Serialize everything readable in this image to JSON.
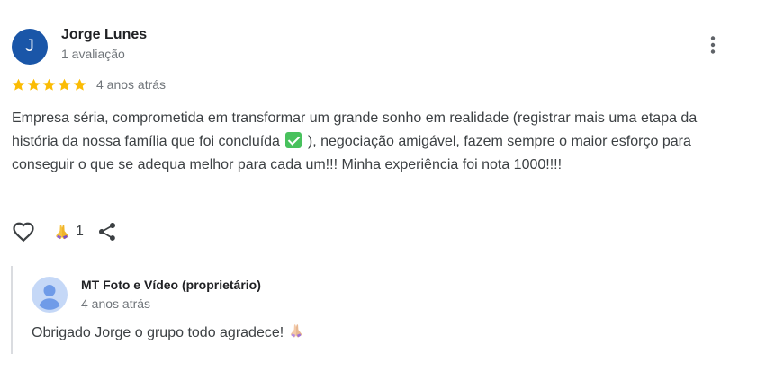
{
  "review": {
    "author": {
      "initial": "J",
      "name": "Jorge Lunes",
      "meta": "1 avaliação",
      "avatar_color": "#1a56a8"
    },
    "rating": 5,
    "rating_max": 5,
    "star_color": "#fbbc04",
    "date": "4 anos atrás",
    "text_before_emoji": "Empresa séria, comprometida em transformar um grande sonho em realidade (registrar mais uma etapa da história da nossa família que foi concluída",
    "text_after_emoji": "), negociação amigável, fazem sempre o maior esforço para conseguir o que se adequa melhor para cada um!!! Minha experiência foi nota 1000!!!!",
    "emoji": "check-mark-button",
    "reactions": {
      "icon": "folded-hands-icon",
      "count": "1"
    }
  },
  "owner_response": {
    "name": "MT Foto e Vídeo (proprietário)",
    "date": "4 anos atrás",
    "text": "Obrigado Jorge o grupo todo agradece!",
    "emoji": "folded-hands"
  },
  "colors": {
    "text_primary": "#202124",
    "text_secondary": "#70757a",
    "reply_border": "#dadce0",
    "owner_avatar_bg": "#c5d8f7",
    "owner_avatar_fg": "#6f9be8"
  }
}
